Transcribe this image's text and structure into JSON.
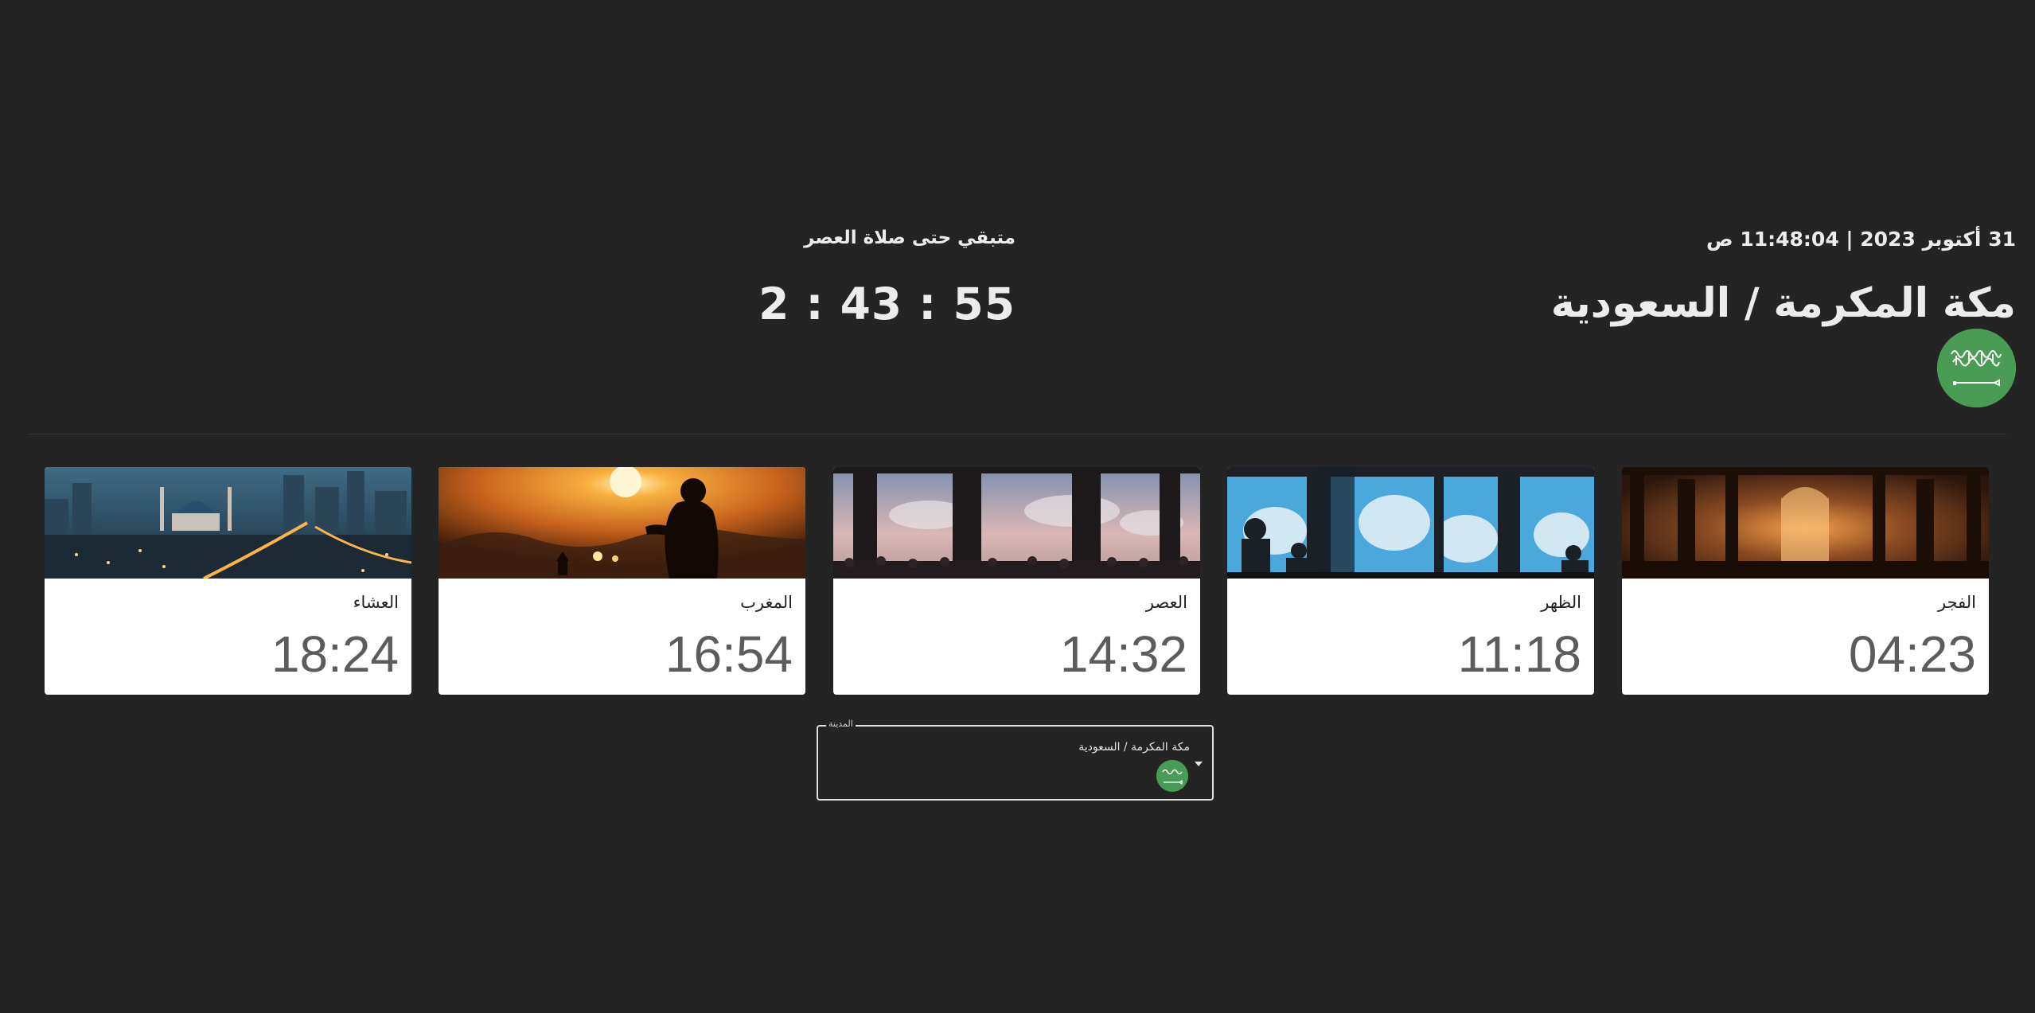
{
  "header": {
    "datetime": "31 أكتوبر 2023 | 11:48:04 ص",
    "city_title": "مكة المكرمة / السعودية",
    "flag_icon": "saudi-flag-icon",
    "flag_color": "#4a9c55"
  },
  "countdown": {
    "label": "متبقي حتى صلاة العصر",
    "value": "2 : 43 : 55"
  },
  "prayers": [
    {
      "name": "الفجر",
      "time": "04:23",
      "image": "mosque-interior-sunrise"
    },
    {
      "name": "الظهر",
      "time": "11:18",
      "image": "window-silhouettes-sky"
    },
    {
      "name": "العصر",
      "time": "14:32",
      "image": "colonnade-crowd-sky"
    },
    {
      "name": "المغرب",
      "time": "16:54",
      "image": "man-praying-sunset"
    },
    {
      "name": "العشاء",
      "time": "18:24",
      "image": "city-night-mosque"
    }
  ],
  "city_select": {
    "legend": "المدينة",
    "value": "مكة المكرمة / السعودية",
    "flag_icon": "saudi-flag-icon",
    "arrow_icon": "caret-down-icon"
  }
}
